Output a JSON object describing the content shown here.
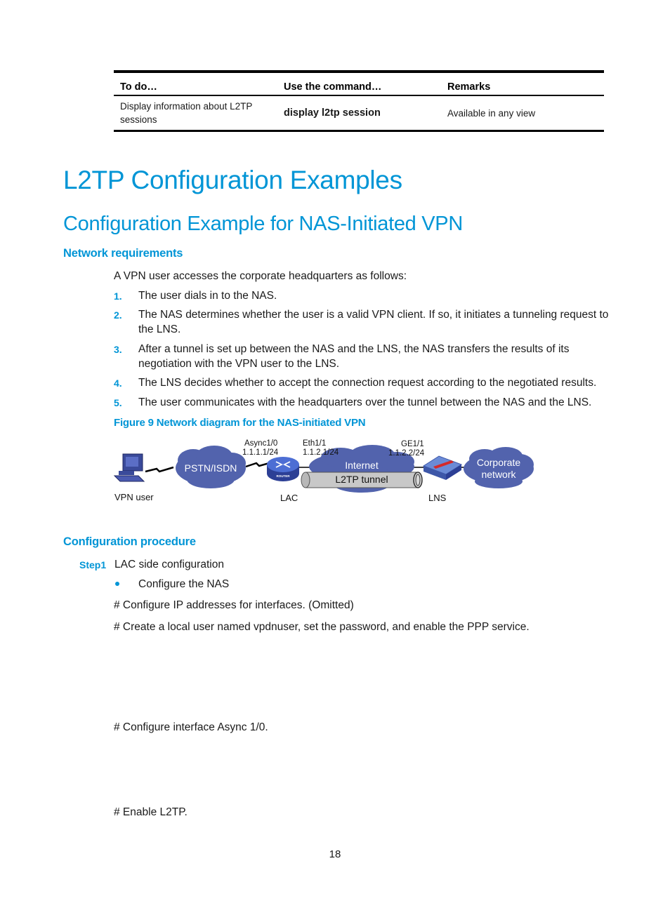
{
  "table": {
    "headers": [
      "To do…",
      "Use the command…",
      "Remarks"
    ],
    "rows": [
      [
        "Display information about L2TP sessions",
        "display l2tp session",
        "Available in any view"
      ]
    ]
  },
  "heading1": "L2TP Configuration Examples",
  "heading2": "Configuration Example for NAS-Initiated VPN",
  "network_requirements": {
    "title": "Network requirements",
    "intro": "A VPN user accesses the corporate headquarters as follows:",
    "steps": [
      {
        "num": "1.",
        "text": "The user dials in to the NAS."
      },
      {
        "num": "2.",
        "text": "The NAS determines whether the user is a valid VPN client. If so, it initiates a tunneling request to the LNS."
      },
      {
        "num": "3.",
        "text": "After a tunnel is set up between the NAS and the LNS, the NAS transfers the results of its negotiation with the VPN user to the LNS."
      },
      {
        "num": "4.",
        "text": "The LNS decides whether to accept the connection request according to the negotiated results."
      },
      {
        "num": "5.",
        "text": "The user communicates with the headquarters over the tunnel between the NAS and the LNS."
      }
    ]
  },
  "figure": {
    "caption": "Figure 9 Network diagram for the NAS-initiated VPN",
    "nodes": {
      "vpn_user": "VPN user",
      "pstn": "PSTN/ISDN",
      "lac": "LAC",
      "router_badge": "ROUTER",
      "internet": "Internet",
      "tunnel": "L2TP tunnel",
      "lns": "LNS",
      "corporate_line1": "Corporate",
      "corporate_line2": "network"
    },
    "interfaces": {
      "async_name": "Async1/0",
      "async_ip": "1.1.1.1/24",
      "eth_name": "Eth1/1",
      "eth_ip": "1.1.2.1/24",
      "ge_name": "GE1/1",
      "ge_ip": "1.1.2.2/24"
    },
    "colors": {
      "cloud": "#5263ad",
      "router": "#3f5cc0",
      "tunnel": "#c8c8c8"
    }
  },
  "procedure": {
    "title": "Configuration procedure",
    "step_label": "Step1",
    "step_text": "LAC side configuration",
    "bullet": "Configure the NAS",
    "comments": [
      "# Configure IP addresses for interfaces. (Omitted)",
      "# Create a local user named vpdnuser, set the password, and enable the PPP service.",
      "# Configure interface Async 1/0.",
      "# Enable L2TP."
    ]
  },
  "page_number": "18"
}
